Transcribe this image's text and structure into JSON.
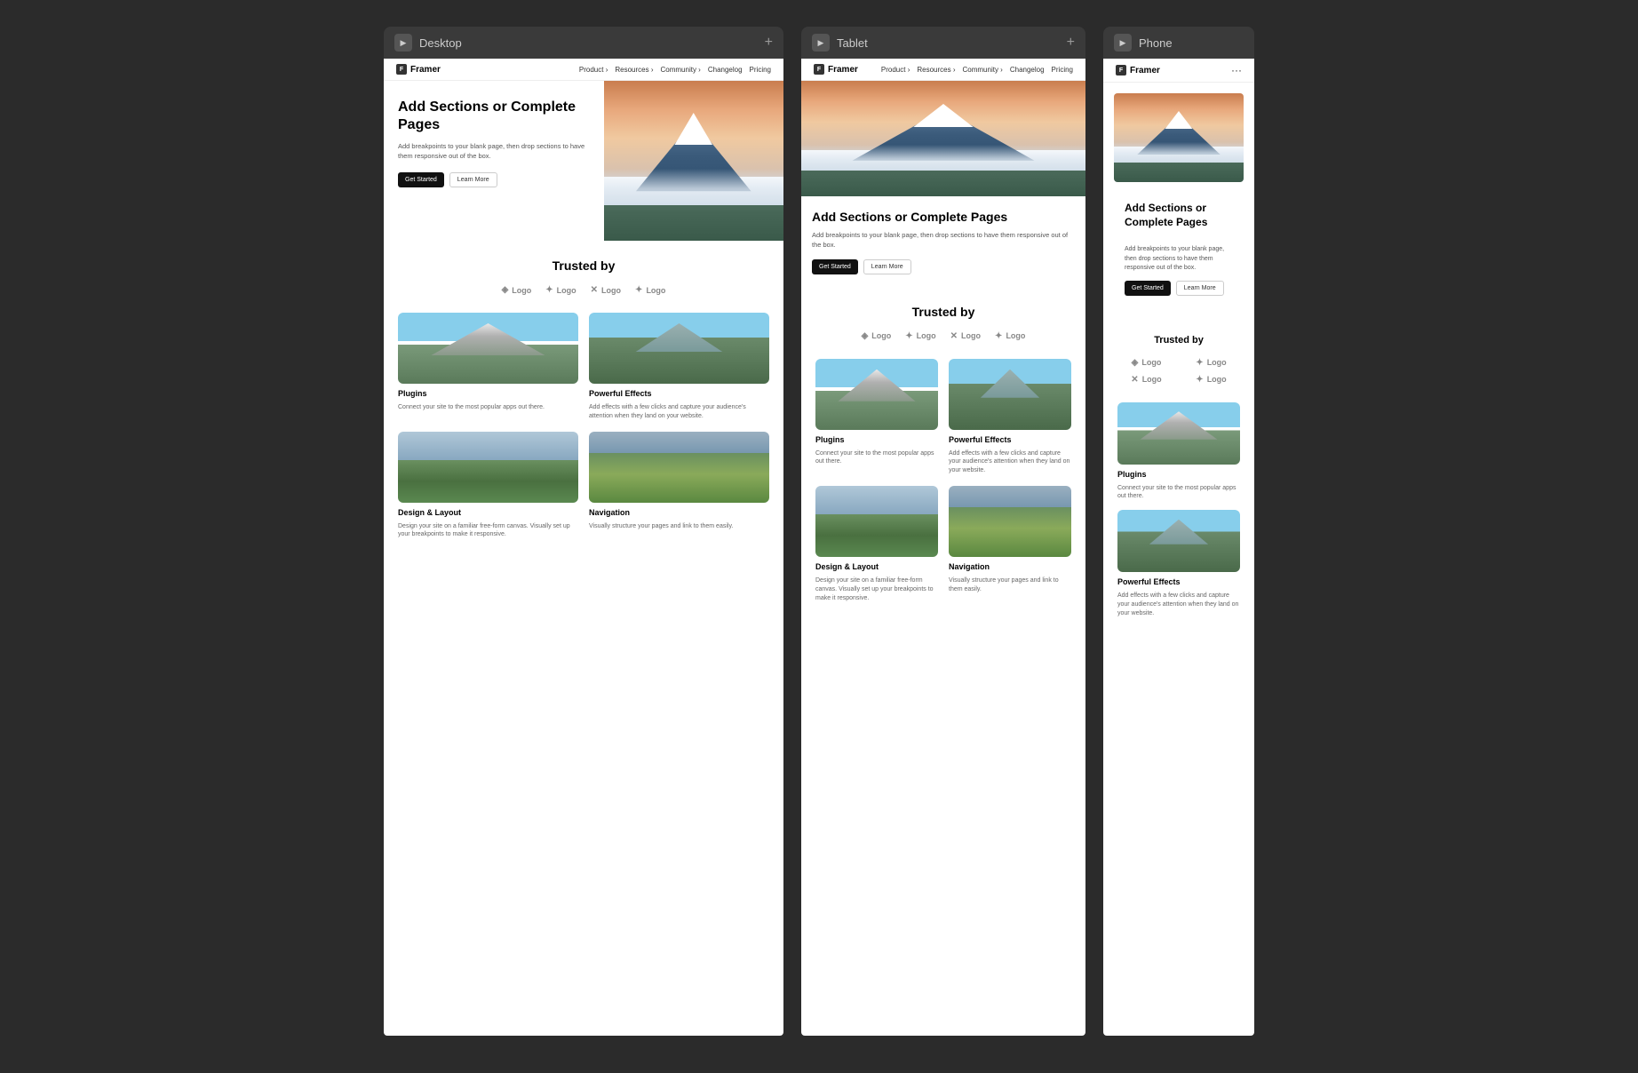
{
  "devices": {
    "desktop": {
      "label": "Desktop",
      "add_icon": "+"
    },
    "tablet": {
      "label": "Tablet",
      "add_icon": "+"
    },
    "phone": {
      "label": "Phone"
    }
  },
  "navbar": {
    "brand": "Framer",
    "links": [
      "Product ›",
      "Resources ›",
      "Community ›",
      "Changelog",
      "Pricing"
    ]
  },
  "hero": {
    "title": "Add Sections or Complete Pages",
    "description": "Add breakpoints to your blank page, then drop sections to have them responsive out of the box.",
    "btn_primary": "Get Started",
    "btn_secondary": "Learn More"
  },
  "trusted": {
    "heading": "Trusted by",
    "logos": [
      {
        "icon": "◈",
        "name": "Logo"
      },
      {
        "icon": "✦",
        "name": "Logo"
      },
      {
        "icon": "✕",
        "name": "Logo"
      },
      {
        "icon": "✦",
        "name": "Logo"
      }
    ]
  },
  "features": [
    {
      "title": "Plugins",
      "description": "Connect your site to the most popular apps out there."
    },
    {
      "title": "Powerful Effects",
      "description": "Add effects with a few clicks and capture your audience's attention when they land on your website."
    },
    {
      "title": "Design & Layout",
      "description": "Design your site on a familiar free-form canvas. Visually set up your breakpoints to make it responsive."
    },
    {
      "title": "Navigation",
      "description": "Visually structure your pages and link to them easily."
    }
  ]
}
